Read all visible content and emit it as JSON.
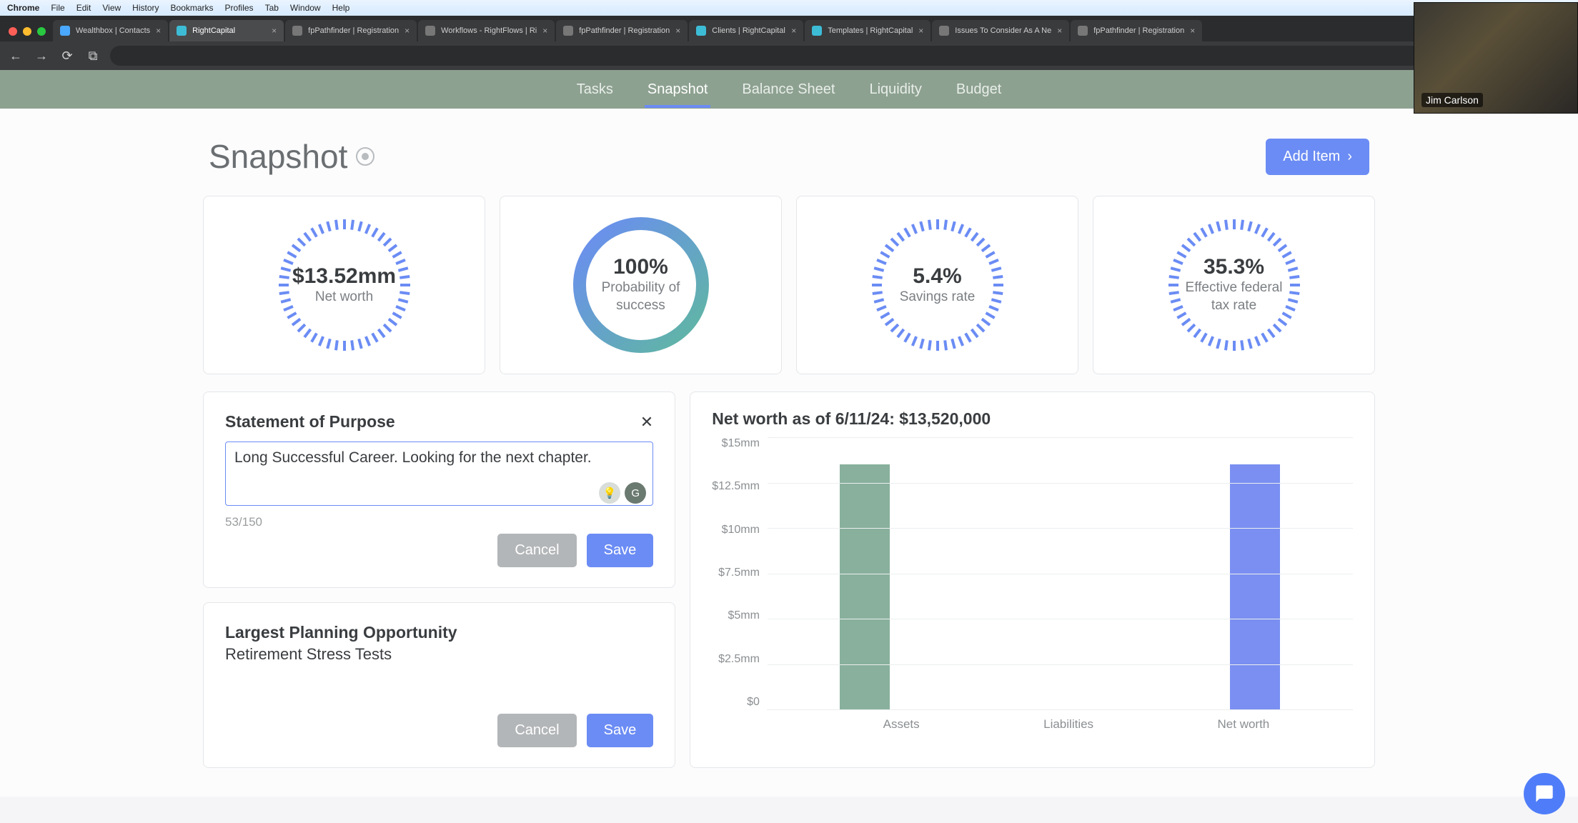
{
  "mac_menu": {
    "app": "Chrome",
    "items": [
      "File",
      "Edit",
      "View",
      "History",
      "Bookmarks",
      "Profiles",
      "Tab",
      "Window",
      "Help"
    ]
  },
  "tabs": [
    {
      "title": "Wealthbox | Contacts",
      "favicon": "#4aa8ff",
      "active": false
    },
    {
      "title": "RightCapital",
      "favicon": "#3dbcd6",
      "active": true
    },
    {
      "title": "fpPathfinder | Registration",
      "favicon": "#777",
      "active": false
    },
    {
      "title": "Workflows - RightFlows | Ri",
      "favicon": "#777",
      "active": false
    },
    {
      "title": "fpPathfinder | Registration",
      "favicon": "#777",
      "active": false
    },
    {
      "title": "Clients | RightCapital",
      "favicon": "#3dbcd6",
      "active": false
    },
    {
      "title": "Templates | RightCapital",
      "favicon": "#3dbcd6",
      "active": false
    },
    {
      "title": "Issues To Consider As A Ne",
      "favicon": "#777",
      "active": false
    },
    {
      "title": "fpPathfinder | Registration",
      "favicon": "#777",
      "active": false
    }
  ],
  "appnav": {
    "items": [
      "Tasks",
      "Snapshot",
      "Balance Sheet",
      "Liquidity",
      "Budget"
    ],
    "active": "Snapshot"
  },
  "header": {
    "title": "Snapshot",
    "add_label": "Add Item"
  },
  "kpis": [
    {
      "value": "$13.52mm",
      "label": "Net worth",
      "style": "dashed"
    },
    {
      "value": "100%",
      "label": "Probability of success",
      "style": "solid"
    },
    {
      "value": "5.4%",
      "label": "Savings rate",
      "style": "dashed"
    },
    {
      "value": "35.3%",
      "label": "Effective federal tax rate",
      "style": "dashed"
    }
  ],
  "sop": {
    "title": "Statement of Purpose",
    "value": "Long Successful Career. Looking for the next chapter.",
    "count": "53/150",
    "cancel": "Cancel",
    "save": "Save"
  },
  "opportunity": {
    "title": "Largest Planning Opportunity",
    "text": "Retirement Stress Tests",
    "cancel": "Cancel",
    "save": "Save"
  },
  "chart_title": "Net worth as of 6/11/24: $13,520,000",
  "chart_data": {
    "type": "bar",
    "categories": [
      "Assets",
      "Liabilities",
      "Net worth"
    ],
    "values": [
      13.52,
      0,
      13.52
    ],
    "y_ticks": [
      "$15mm",
      "$12.5mm",
      "$10mm",
      "$7.5mm",
      "$5mm",
      "$2.5mm",
      "$0"
    ],
    "ylim": [
      0,
      15
    ],
    "ylabel": "",
    "colors": [
      "#88b09d",
      "#d8a3a0",
      "#7a8ff1"
    ]
  },
  "video": {
    "name": "Jim Carlson"
  }
}
